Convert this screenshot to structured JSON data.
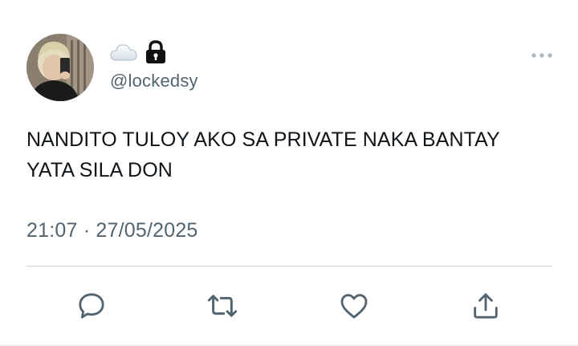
{
  "author": {
    "handle": "@lockedsy",
    "name_icons": [
      "cloud-icon",
      "lock-icon"
    ],
    "avatar": "profile-photo"
  },
  "tweet": {
    "text": "NANDITO TULOY AKO SA PRIVATE NAKA BANTAY YATA SILA DON",
    "time": "21:07",
    "separator": "·",
    "date": "27/05/2025"
  },
  "actions": [
    "reply-icon",
    "retweet-icon",
    "like-icon",
    "share-icon"
  ],
  "colors": {
    "text": "#0f1419",
    "secondary": "#536471",
    "divider": "#cfd9de",
    "icon": "#536471"
  }
}
